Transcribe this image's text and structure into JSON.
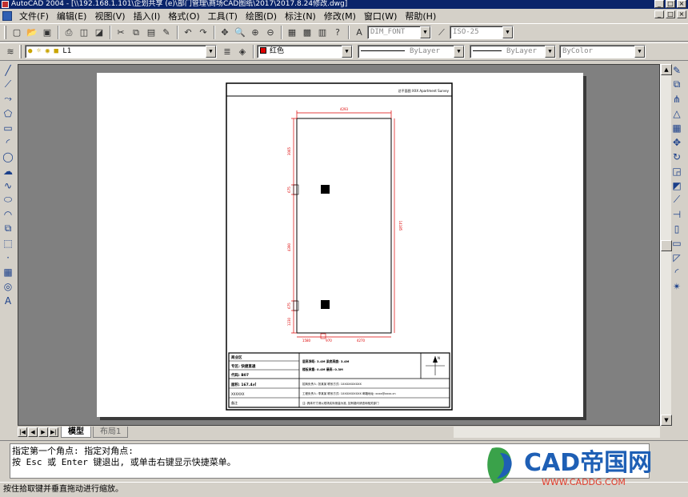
{
  "window": {
    "title": "AutoCAD 2004 - [\\\\192.168.1.101\\企划共享 (e)\\部门管理\\商场CAD图纸\\2017\\2017.8.24修改.dwg]",
    "min": "_",
    "max": "□",
    "close": "×"
  },
  "menu": {
    "items": [
      "文件(F)",
      "编辑(E)",
      "视图(V)",
      "插入(I)",
      "格式(O)",
      "工具(T)",
      "绘图(D)",
      "标注(N)",
      "修改(M)",
      "窗口(W)",
      "帮助(H)"
    ]
  },
  "toolbar": {
    "text_style": "DIM_FONT",
    "dim_style": "ISO-25",
    "layer": "L1",
    "color": "红色",
    "linetype": "ByLayer",
    "lineweight": "ByLayer",
    "plotstyle": "ByColor"
  },
  "drawing": {
    "header": "总平面图  XXX Apartment Survey",
    "dims": {
      "top": "4293",
      "left1": "3065",
      "left2": "675",
      "left3": "4390",
      "left4": "675",
      "left5": "1230",
      "right": "14185",
      "bottom1": "1580",
      "bottom2": "970",
      "bottom3": "4270"
    },
    "titleblock": {
      "r1c1": "商业区",
      "r2c1": "专区: 快捷直通",
      "r3c1": "代码: B07",
      "r4c1": "面积: 167.4㎡",
      "r5c1": "XXXXXX",
      "r6c1": "备注",
      "info1": "层高净距: 3.4M   梁底高度: 3.4M",
      "info2": "楼板承重: 0.4M   最高: 0.3M",
      "info3": "招商负责人: 张某某   联系方式: 1XXXXXXXXXX",
      "info4": "工程负责人: 李某某   联系方式: 1XXXXXXXXXX   邮箱地址: xxxx@xxxx.cn",
      "info5": "注: 具体尺寸请以现场实际测量为准, 如有疑问请咨询相关部门"
    },
    "compass": "N"
  },
  "tabs": {
    "model": "模型",
    "layout": "布局1"
  },
  "command": {
    "line1": "指定第一个角点: 指定对角点:",
    "line2": "按 Esc 或 Enter 键退出, 或单击右键显示快捷菜单。"
  },
  "status": "按住拾取键并垂直拖动进行缩放。",
  "watermark": {
    "brand": "CAD帝国网",
    "url": "WWW.CADDG.COM",
    "brand_color": "#1e5fb5",
    "accent_color": "#3aa24a"
  }
}
